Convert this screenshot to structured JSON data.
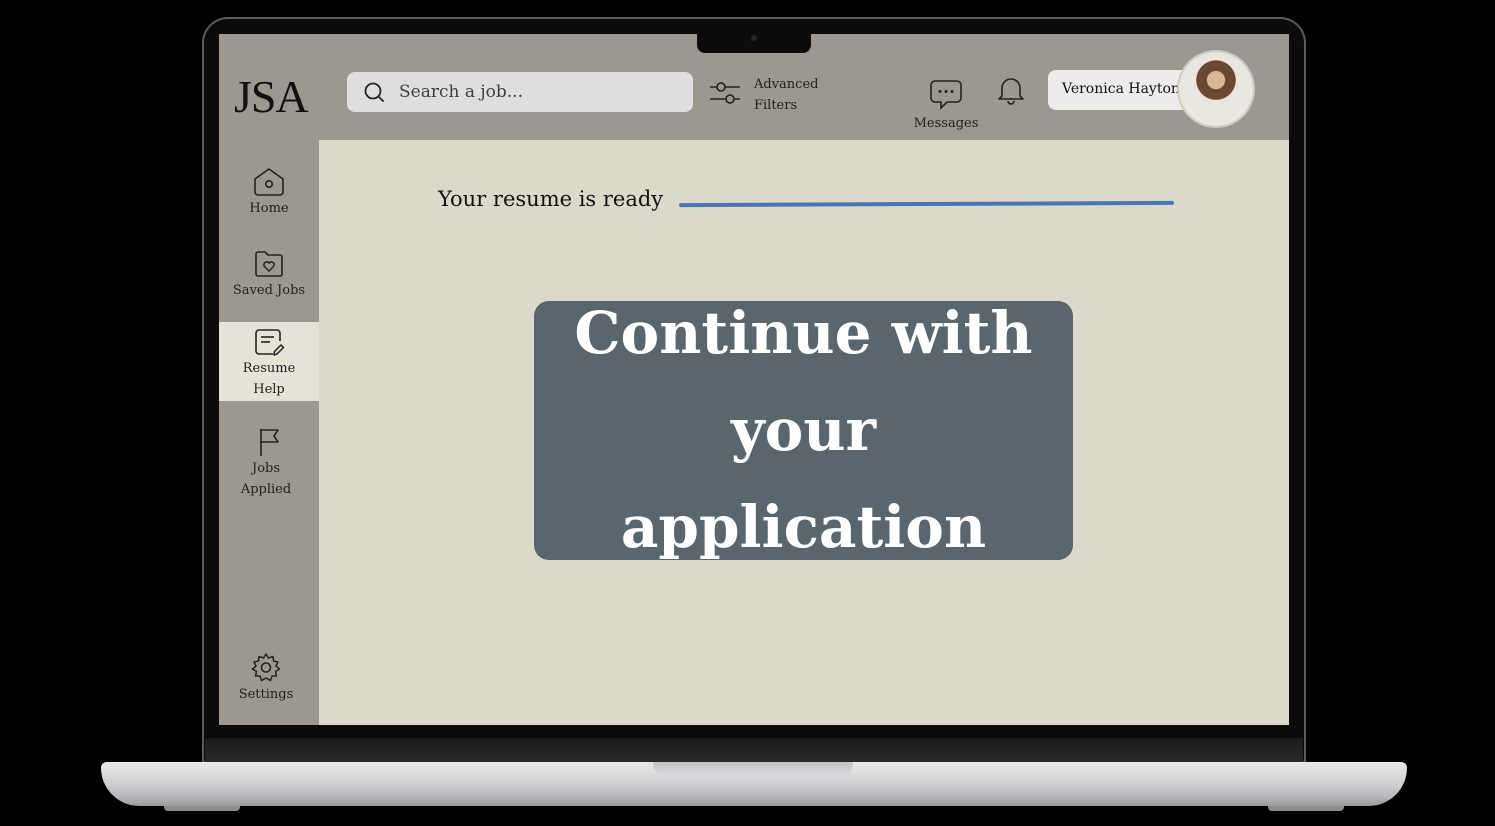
{
  "app": {
    "logo": "JSA"
  },
  "header": {
    "search_placeholder": "Search a job...",
    "advanced_filters_line1": "Advanced",
    "advanced_filters_line2": "Filters",
    "messages_label": "Messages",
    "user_name": "Veronica Hayton"
  },
  "sidebar": {
    "items": [
      {
        "line1": "Home",
        "line2": "",
        "icon": "home-icon"
      },
      {
        "line1": "Saved Jobs",
        "line2": "",
        "icon": "folder-heart-icon"
      },
      {
        "line1": "Resume",
        "line2": "Help",
        "icon": "resume-edit-icon",
        "active": true
      },
      {
        "line1": "Jobs",
        "line2": "Applied",
        "icon": "flag-icon"
      },
      {
        "line1": "Settings",
        "line2": "",
        "icon": "gear-icon"
      }
    ]
  },
  "main": {
    "status_text": "Your resume is ready",
    "progress": 1.0,
    "cta_label": "Continue with your application"
  },
  "colors": {
    "sidebar_bg": "#9c9890",
    "main_bg": "#dcd9cb",
    "active_item_bg": "#e5e2d6",
    "cta_bg": "#59666d",
    "progress": "#4a75b3"
  }
}
